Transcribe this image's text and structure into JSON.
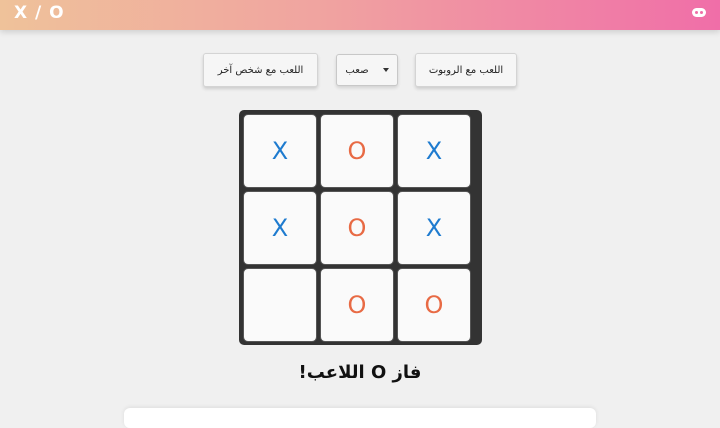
{
  "header": {
    "title": "X / O",
    "icon": "gamepad-icon"
  },
  "controls": {
    "play_robot_label": "اللعب مع الروبوت",
    "difficulty_selected": "صعب",
    "play_person_label": "اللعب مع شخص آخر"
  },
  "board": {
    "cells": [
      "X",
      "O",
      "X",
      "X",
      "O",
      "X",
      "",
      "O",
      "O"
    ]
  },
  "status": {
    "message": "فاز O اللاعب!"
  },
  "colors": {
    "x": "#1e7bcf",
    "o": "#e86a44",
    "board": "#333333"
  }
}
